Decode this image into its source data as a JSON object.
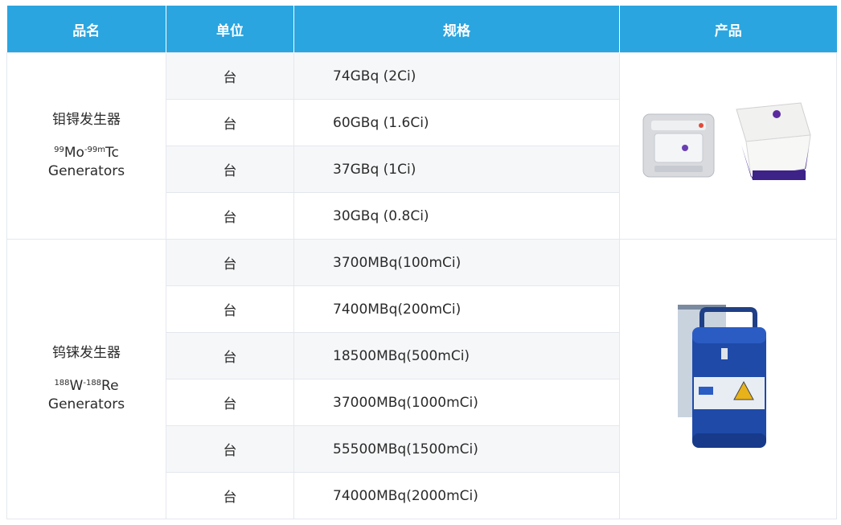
{
  "header": {
    "col_name": "品名",
    "col_unit": "单位",
    "col_spec": "规格",
    "col_product": "产品"
  },
  "groups": [
    {
      "name_cn": "钼锝发生器",
      "iso1_sup": "99",
      "iso1_sym": "Mo",
      "iso2_sup": "-99m",
      "iso2_sym": "Tc",
      "name_en": "Generators",
      "product_image": "mo-tc-generator-product-image",
      "rows": [
        {
          "unit": "台",
          "spec": "74GBq (2Ci)"
        },
        {
          "unit": "台",
          "spec": "60GBq (1.6Ci)"
        },
        {
          "unit": "台",
          "spec": "37GBq (1Ci)"
        },
        {
          "unit": "台",
          "spec": "30GBq (0.8Ci)"
        }
      ]
    },
    {
      "name_cn": "钨铼发生器",
      "iso1_sup": "188",
      "iso1_sym": "W",
      "iso2_sup": "-188",
      "iso2_sym": "Re",
      "name_en": "Generators",
      "product_image": "w-re-generator-product-image",
      "rows": [
        {
          "unit": "台",
          "spec": "3700MBq(100mCi)"
        },
        {
          "unit": "台",
          "spec": "7400MBq(200mCi)"
        },
        {
          "unit": "台",
          "spec": "18500MBq(500mCi)"
        },
        {
          "unit": "台",
          "spec": "37000MBq(1000mCi)"
        },
        {
          "unit": "台",
          "spec": "55500MBq(1500mCi)"
        },
        {
          "unit": "台",
          "spec": "74000MBq(2000mCi)"
        }
      ]
    }
  ]
}
